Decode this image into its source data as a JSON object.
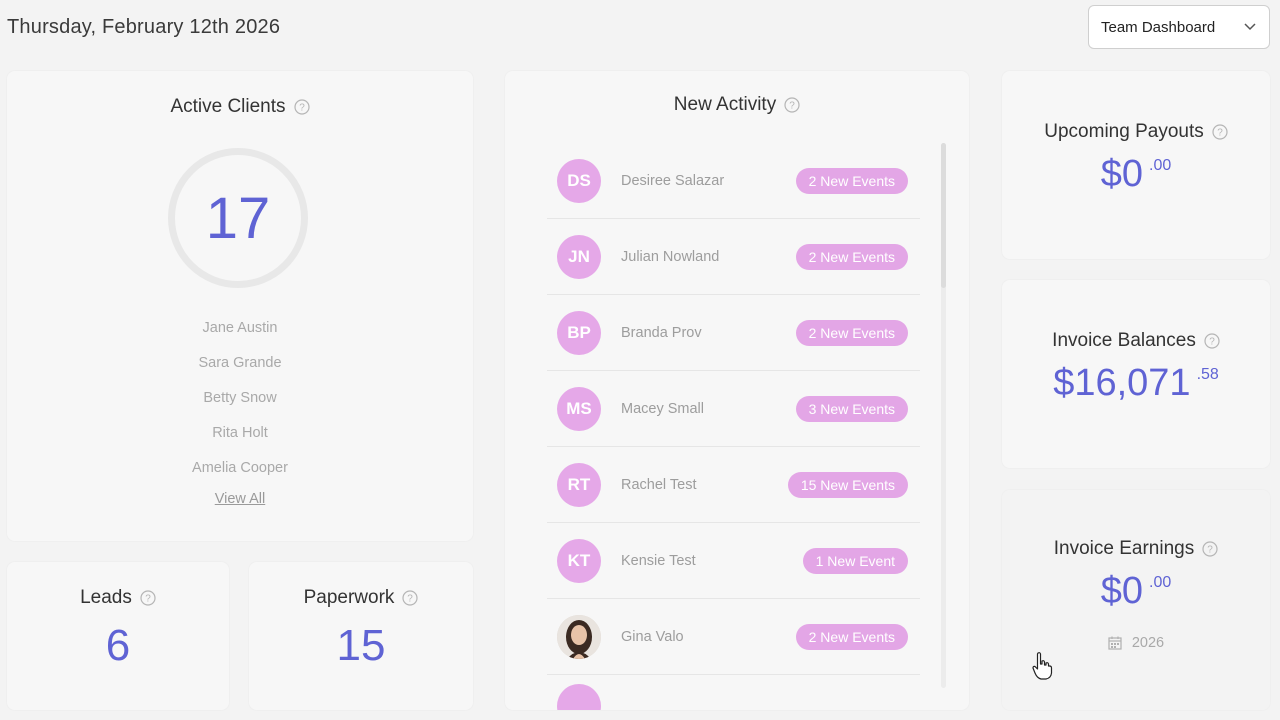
{
  "header": {
    "date": "Thursday, February 12th 2026",
    "dashboard_select": "Team Dashboard"
  },
  "active_clients": {
    "title": "Active Clients",
    "count": "17",
    "clients": [
      "Jane Austin",
      "Sara Grande",
      "Betty Snow",
      "Rita Holt",
      "Amelia Cooper"
    ],
    "view_all": "View All"
  },
  "leads": {
    "title": "Leads",
    "value": "6"
  },
  "paperwork": {
    "title": "Paperwork",
    "value": "15"
  },
  "activity": {
    "title": "New Activity",
    "items": [
      {
        "initials": "DS",
        "name": "Desiree Salazar",
        "badge": "2 New Events"
      },
      {
        "initials": "JN",
        "name": "Julian Nowland",
        "badge": "2 New Events"
      },
      {
        "initials": "BP",
        "name": "Branda Prov",
        "badge": "2 New Events"
      },
      {
        "initials": "MS",
        "name": "Macey Small",
        "badge": "3 New Events"
      },
      {
        "initials": "RT",
        "name": "Rachel Test",
        "badge": "15 New Events"
      },
      {
        "initials": "KT",
        "name": "Kensie Test",
        "badge": "1 New Event"
      },
      {
        "initials": "",
        "name": "Gina Valo",
        "badge": "2 New Events"
      }
    ]
  },
  "upcoming_payouts": {
    "title": "Upcoming Payouts",
    "amount": "$0",
    "cents": ".00"
  },
  "invoice_balances": {
    "title": "Invoice Balances",
    "amount": "$16,071",
    "cents": ".58"
  },
  "invoice_earnings": {
    "title": "Invoice Earnings",
    "amount": "$0",
    "cents": ".00",
    "year": "2026"
  },
  "colors": {
    "accent": "#5f63d4",
    "badge": "#e3a6e6",
    "avatar": "#e5a8e8"
  }
}
